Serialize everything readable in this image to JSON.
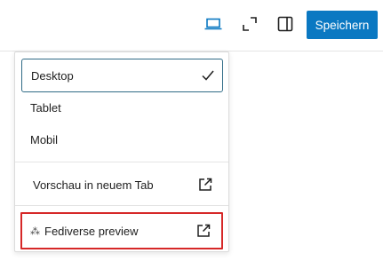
{
  "toolbar": {
    "device_icon": "laptop-icon",
    "fullscreen_icon": "fullscreen-icon",
    "sidebar_icon": "sidebar-toggle-icon",
    "save_label": "Speichern",
    "accent_color": "#0a78c2"
  },
  "menu": {
    "devices": [
      {
        "label": "Desktop",
        "selected": true
      },
      {
        "label": "Tablet",
        "selected": false
      },
      {
        "label": "Mobil",
        "selected": false
      }
    ],
    "preview_tab_label": "Vorschau in neuem Tab",
    "fediverse_label": "Fediverse preview",
    "fediverse_icon_glyph": "⁂",
    "highlight_color": "#d62828"
  }
}
